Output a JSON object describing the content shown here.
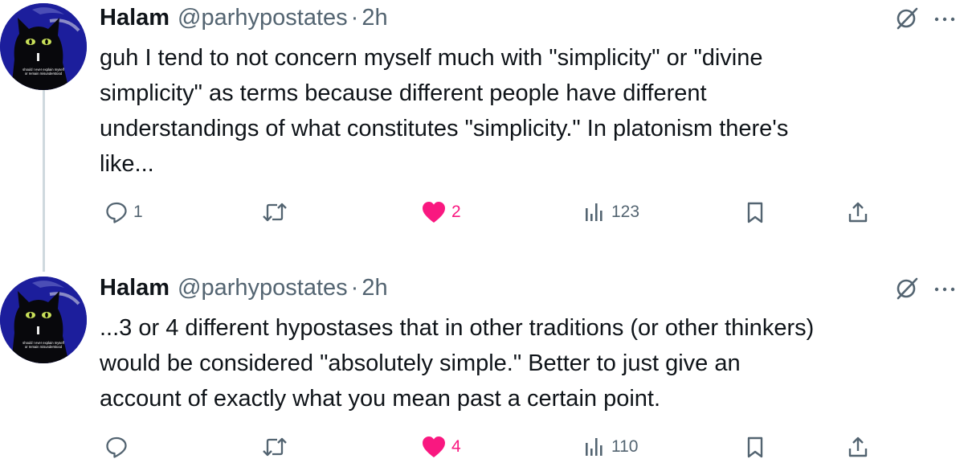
{
  "tweets": [
    {
      "author": {
        "name": "Halam",
        "handle": "@parhypostates",
        "time": "2h",
        "avatar_caption_1": "should I ever explain myself",
        "avatar_caption_2": "or remain misunderstood"
      },
      "lines": [
        "guh I tend to not concern myself much with \"simplicity\" or \"divine",
        "simplicity\" as terms because different people have different",
        "understandings of what constitutes \"simplicity.\" In platonism there's",
        "like..."
      ],
      "actions": {
        "replies": "1",
        "retweets": "",
        "likes": "2",
        "views": "123"
      },
      "liked": true
    },
    {
      "author": {
        "name": "Halam",
        "handle": "@parhypostates",
        "time": "2h",
        "avatar_caption_1": "should I ever explain myself",
        "avatar_caption_2": "or remain misunderstood"
      },
      "lines": [
        "...3 or 4 different hypostases that in other traditions (or other thinkers)",
        "would be considered \"absolutely simple.\" Better to just give an",
        "account of exactly what you mean past a certain point."
      ],
      "actions": {
        "replies": "",
        "retweets": "",
        "likes": "4",
        "views": "110"
      },
      "liked": true
    }
  ],
  "separator": "·",
  "colors": {
    "like": "#f91880",
    "muted": "#536471",
    "text": "#0f1419",
    "thread_line": "#cfd9de",
    "avatar_bg": "#1c1e9c"
  },
  "icons": [
    "reply-icon",
    "retweet-icon",
    "heart-icon",
    "views-icon",
    "bookmark-icon",
    "share-icon",
    "grok-icon",
    "more-icon"
  ]
}
